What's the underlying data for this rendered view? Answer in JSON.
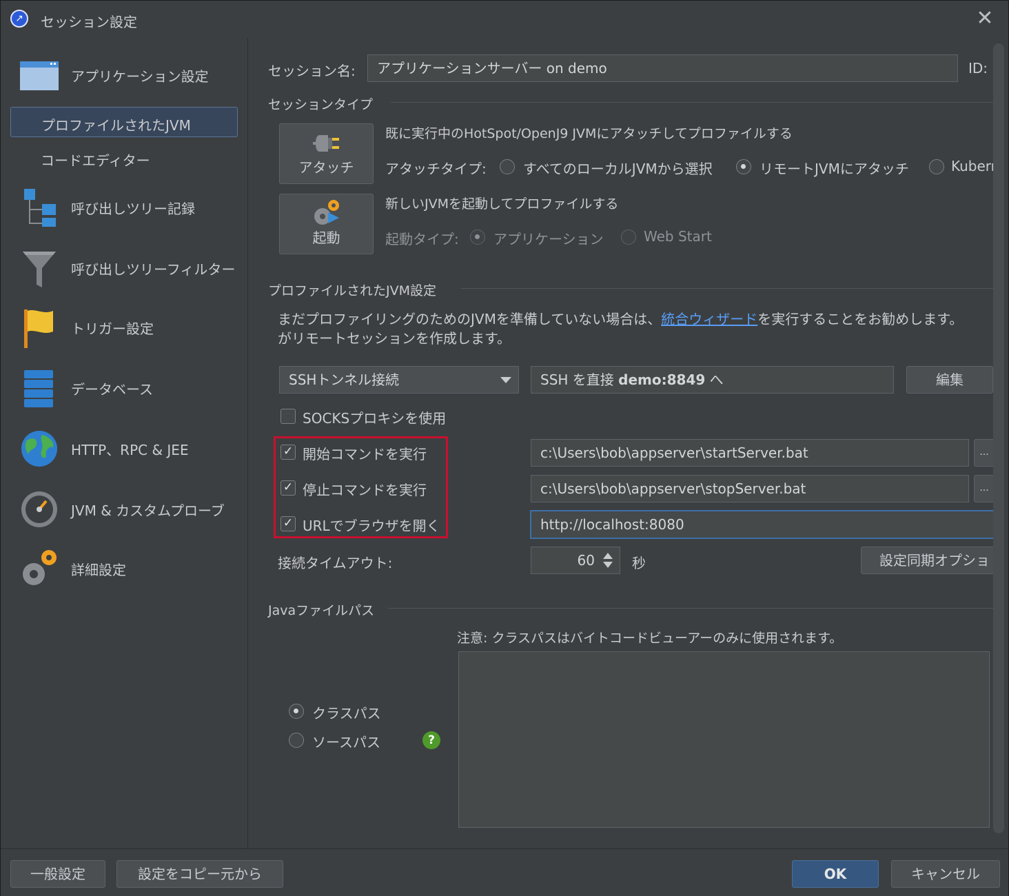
{
  "window": {
    "title": "セッション設定",
    "close_glyph": "✕"
  },
  "sidebar": {
    "items": [
      {
        "label": "アプリケーション設定",
        "icon": "application-window-icon"
      },
      {
        "label": "プロファイルされたJVM",
        "selected": true
      },
      {
        "label": "コードエディター"
      },
      {
        "label": "呼び出しツリー記録",
        "icon": "call-tree-icon"
      },
      {
        "label": "呼び出しツリーフィルター",
        "icon": "funnel-icon"
      },
      {
        "label": "トリガー設定",
        "icon": "flag-icon"
      },
      {
        "label": "データベース",
        "icon": "database-icon"
      },
      {
        "label": "HTTP、RPC & JEE",
        "icon": "globe-icon"
      },
      {
        "label": "JVM & カスタムプローブ",
        "icon": "gauge-icon"
      },
      {
        "label": "詳細設定",
        "icon": "gears-icon"
      }
    ]
  },
  "session": {
    "name_label": "セッション名:",
    "name_value": "アプリケーションサーバー on demo",
    "id_label": "ID:"
  },
  "session_type": {
    "header": "セッションタイプ",
    "attach_button": "アタッチ",
    "attach_desc": "既に実行中のHotSpot/OpenJ9 JVMにアタッチしてプロファイルする",
    "attach_type_label": "アタッチタイプ:",
    "attach_options": [
      "すべてのローカルJVMから選択",
      "リモートJVMにアタッチ",
      "Kubern"
    ],
    "attach_selected": 1,
    "launch_button": "起動",
    "launch_desc": "新しいJVMを起動してプロファイルする",
    "launch_type_label": "起動タイプ:",
    "launch_options": [
      "アプリケーション",
      "Web Start"
    ]
  },
  "jvm_settings": {
    "header": "プロファイルされたJVM設定",
    "info_pre": "まだプロファイリングのためのJVMを準備していない場合は、",
    "info_link": "統合ウィザード",
    "info_post": "を実行することをお勧めします。",
    "info_line2": "がリモートセッションを作成します。",
    "connection_type": "SSHトンネル接続",
    "ssh_prefix": "SSH を直接 ",
    "ssh_host": "demo:8849",
    "ssh_suffix": " へ",
    "edit_button": "編集",
    "socks_label": "SOCKSプロキシを使用",
    "start_cmd_label": "開始コマンドを実行",
    "start_cmd_value": "c:\\Users\\bob\\appserver\\startServer.bat",
    "stop_cmd_label": "停止コマンドを実行",
    "stop_cmd_value": "c:\\Users\\bob\\appserver\\stopServer.bat",
    "url_label": "URLでブラウザを開く",
    "url_value": "http://localhost:8080",
    "browse_glyph": "...",
    "timeout_label": "接続タイムアウト:",
    "timeout_value": "60",
    "timeout_unit": "秒",
    "sync_button": "設定同期オプショ"
  },
  "java_path": {
    "header": "Javaファイルパス",
    "note": "注意: クラスパスはバイトコードビューアーのみに使用されます。",
    "classpath_label": "クラスパス",
    "sourcepath_label": "ソースパス",
    "help_glyph": "?"
  },
  "footer": {
    "general_button": "一般設定",
    "copy_button": "設定をコピー元から",
    "ok_button": "OK",
    "cancel_button": "キャンセル"
  },
  "colors": {
    "accent": "#365880",
    "highlight_border": "#c8102e",
    "link": "#589df6"
  }
}
